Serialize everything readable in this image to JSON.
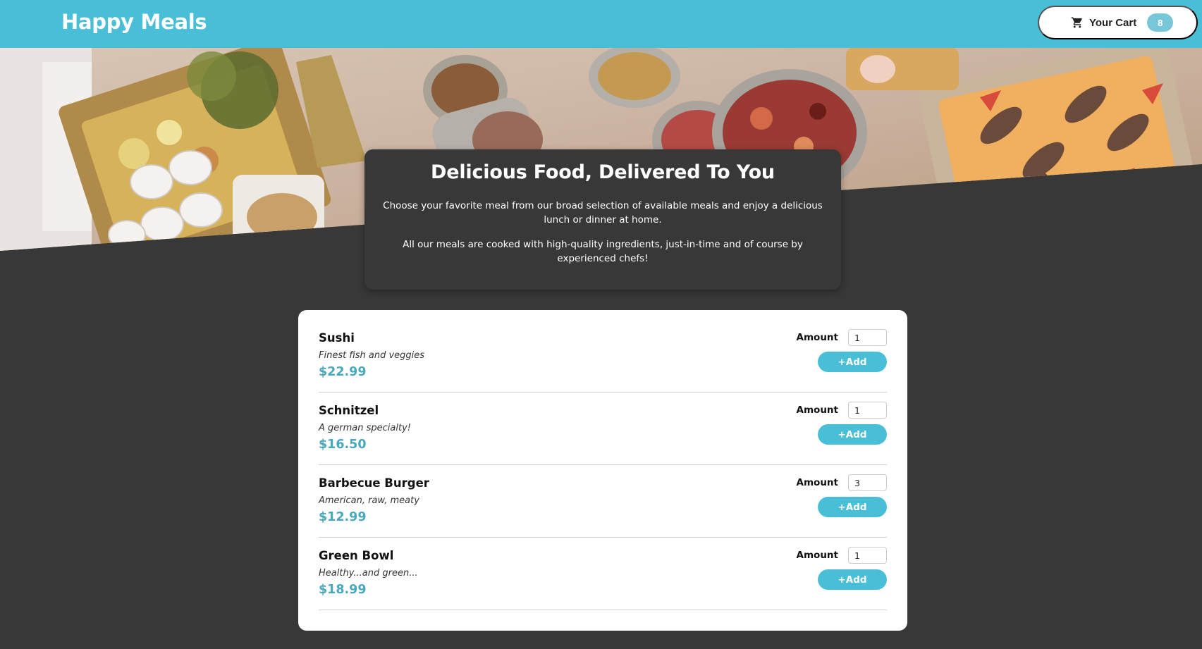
{
  "header": {
    "brand": "Happy Meals",
    "cart_label": "Your Cart",
    "cart_count": "8",
    "cart_icon": "shopping-cart-icon"
  },
  "hero": {
    "image": "buffet-table-food-photo"
  },
  "summary": {
    "title": "Delicious Food, Delivered To You",
    "paragraph_1": "Choose your favorite meal from our broad selection of available meals and enjoy a delicious lunch or dinner at home.",
    "paragraph_2": "All our meals are cooked with high-quality ingredients, just-in-time and of course by experienced chefs!"
  },
  "meals": {
    "amount_label": "Amount",
    "add_label": "+Add",
    "items": [
      {
        "name": "Sushi",
        "description": "Finest fish and veggies",
        "price": "$22.99",
        "amount": "1"
      },
      {
        "name": "Schnitzel",
        "description": "A german specialty!",
        "price": "$16.50",
        "amount": "1"
      },
      {
        "name": "Barbecue Burger",
        "description": "American, raw, meaty",
        "price": "$12.99",
        "amount": "3"
      },
      {
        "name": "Green Bowl",
        "description": "Healthy...and green...",
        "price": "$18.99",
        "amount": "1"
      }
    ]
  },
  "colors": {
    "primary": "#48bfd6",
    "badge": "#78c7d8",
    "background": "#383838",
    "price": "#48a8bd"
  }
}
